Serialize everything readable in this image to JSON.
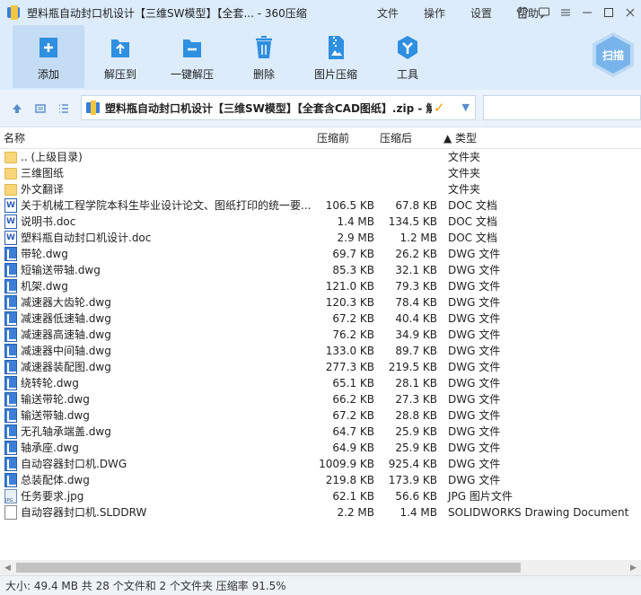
{
  "window": {
    "title": "塑料瓶自动封口机设计【三维SW模型】【全套... - 360压缩",
    "menus": [
      "文件",
      "操作",
      "设置",
      "帮助"
    ]
  },
  "toolbar": {
    "items": [
      {
        "label": "添加",
        "icon": "add-icon"
      },
      {
        "label": "解压到",
        "icon": "extract-to-icon"
      },
      {
        "label": "一键解压",
        "icon": "quick-extract-icon"
      },
      {
        "label": "删除",
        "icon": "delete-icon"
      },
      {
        "label": "图片压缩",
        "icon": "image-compress-icon"
      },
      {
        "label": "工具",
        "icon": "tools-icon"
      }
    ],
    "scan_label": "扫描"
  },
  "address": {
    "path": "塑料瓶自动封口机设计【三维SW模型】【全套含CAD图纸】.zip - 解"
  },
  "columns": {
    "name": "名称",
    "before": "压缩前",
    "after": "压缩后",
    "type": "▲ 类型"
  },
  "files": [
    {
      "name": ".. (上级目录)",
      "before": "",
      "after": "",
      "type": "文件夹",
      "icon": "folder"
    },
    {
      "name": "三维图纸",
      "before": "",
      "after": "",
      "type": "文件夹",
      "icon": "folder"
    },
    {
      "name": "外文翻译",
      "before": "",
      "after": "",
      "type": "文件夹",
      "icon": "folder"
    },
    {
      "name": "关于机械工程学院本科生毕业设计论文、图纸打印的统一要...",
      "before": "106.5 KB",
      "after": "67.8 KB",
      "type": "DOC 文档",
      "icon": "doc"
    },
    {
      "name": "说明书.doc",
      "before": "1.4 MB",
      "after": "134.5 KB",
      "type": "DOC 文档",
      "icon": "doc"
    },
    {
      "name": "塑料瓶自动封口机设计.doc",
      "before": "2.9 MB",
      "after": "1.2 MB",
      "type": "DOC 文档",
      "icon": "doc"
    },
    {
      "name": "带轮.dwg",
      "before": "69.7 KB",
      "after": "26.2 KB",
      "type": "DWG 文件",
      "icon": "dwg"
    },
    {
      "name": "短输送带轴.dwg",
      "before": "85.3 KB",
      "after": "32.1 KB",
      "type": "DWG 文件",
      "icon": "dwg"
    },
    {
      "name": "机架.dwg",
      "before": "121.0 KB",
      "after": "79.3 KB",
      "type": "DWG 文件",
      "icon": "dwg"
    },
    {
      "name": "减速器大齿轮.dwg",
      "before": "120.3 KB",
      "after": "78.4 KB",
      "type": "DWG 文件",
      "icon": "dwg"
    },
    {
      "name": "减速器低速轴.dwg",
      "before": "67.2 KB",
      "after": "40.4 KB",
      "type": "DWG 文件",
      "icon": "dwg"
    },
    {
      "name": "减速器高速轴.dwg",
      "before": "76.2 KB",
      "after": "34.9 KB",
      "type": "DWG 文件",
      "icon": "dwg"
    },
    {
      "name": "减速器中间轴.dwg",
      "before": "133.0 KB",
      "after": "89.7 KB",
      "type": "DWG 文件",
      "icon": "dwg"
    },
    {
      "name": "减速器装配图.dwg",
      "before": "277.3 KB",
      "after": "219.5 KB",
      "type": "DWG 文件",
      "icon": "dwg"
    },
    {
      "name": "绕转轮.dwg",
      "before": "65.1 KB",
      "after": "28.1 KB",
      "type": "DWG 文件",
      "icon": "dwg"
    },
    {
      "name": "输送带轮.dwg",
      "before": "66.2 KB",
      "after": "27.3 KB",
      "type": "DWG 文件",
      "icon": "dwg"
    },
    {
      "name": "输送带轴.dwg",
      "before": "67.2 KB",
      "after": "28.8 KB",
      "type": "DWG 文件",
      "icon": "dwg"
    },
    {
      "name": "无孔轴承端盖.dwg",
      "before": "64.7 KB",
      "after": "25.9 KB",
      "type": "DWG 文件",
      "icon": "dwg"
    },
    {
      "name": "轴承座.dwg",
      "before": "64.9 KB",
      "after": "25.9 KB",
      "type": "DWG 文件",
      "icon": "dwg"
    },
    {
      "name": "自动容器封口机.DWG",
      "before": "1009.9 KB",
      "after": "925.4 KB",
      "type": "DWG 文件",
      "icon": "dwg"
    },
    {
      "name": "总装配体.dwg",
      "before": "219.8 KB",
      "after": "173.9 KB",
      "type": "DWG 文件",
      "icon": "dwg"
    },
    {
      "name": "任务要求.jpg",
      "before": "62.1 KB",
      "after": "56.6 KB",
      "type": "JPG 图片文件",
      "icon": "jpg"
    },
    {
      "name": "自动容器封口机.SLDDRW",
      "before": "2.2 MB",
      "after": "1.4 MB",
      "type": "SOLIDWORKS Drawing Document",
      "icon": "file"
    }
  ],
  "status": {
    "text": "大小: 49.4 MB 共 28 个文件和 2 个文件夹 压缩率 91.5%"
  },
  "colors": {
    "toolbar_bg": "#dcecfb",
    "accent": "#2f8fe0",
    "folder": "#f8d67a",
    "dwg": "#3d7fd6"
  }
}
